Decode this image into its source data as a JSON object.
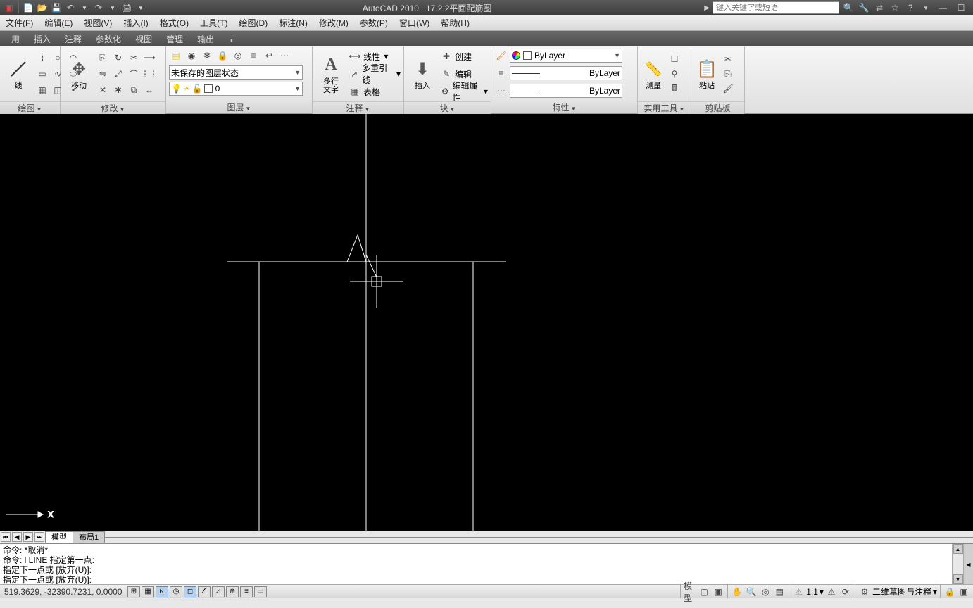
{
  "titlebar": {
    "app": "AutoCAD 2010",
    "doc": "17.2.2平面配筋图",
    "search_placeholder": "键入关键字或短语",
    "qat_icons": [
      "new",
      "open",
      "save",
      "undo",
      "redo",
      "print"
    ]
  },
  "menubar": [
    {
      "label": "文件",
      "key": "F"
    },
    {
      "label": "编辑",
      "key": "E"
    },
    {
      "label": "视图",
      "key": "V"
    },
    {
      "label": "插入",
      "key": "I"
    },
    {
      "label": "格式",
      "key": "O"
    },
    {
      "label": "工具",
      "key": "T"
    },
    {
      "label": "绘图",
      "key": "D"
    },
    {
      "label": "标注",
      "key": "N"
    },
    {
      "label": "修改",
      "key": "M"
    },
    {
      "label": "参数",
      "key": "P"
    },
    {
      "label": "窗口",
      "key": "W"
    },
    {
      "label": "帮助",
      "key": "H"
    }
  ],
  "tabs": [
    "用",
    "插入",
    "注释",
    "参数化",
    "视图",
    "管理",
    "输出"
  ],
  "ribbon": {
    "panels": {
      "draw": "绘图",
      "modify": "修改",
      "layer": "图层",
      "annot": "注释",
      "block": "块",
      "props": "特性",
      "util": "实用工具",
      "clip": "剪贴板"
    },
    "line_label": "线",
    "move_label": "移动",
    "text_label": "多行\n文字",
    "insert_label": "插入",
    "measure_label": "测量",
    "paste_label": "粘贴",
    "layer_state": "未保存的图层状态",
    "layer_current": "0",
    "annot_linear": "线性",
    "annot_mleader": "多重引线",
    "annot_table": "表格",
    "block_create": "创建",
    "block_edit": "编辑",
    "block_editattr": "编辑属性",
    "props_color": "ByLayer",
    "props_ltype": "ByLayer",
    "props_lweight": "ByLayer"
  },
  "model_tabs": {
    "model": "模型",
    "layout1": "布局1"
  },
  "command": {
    "line1": "命令: *取消*",
    "line2": "命令: l LINE 指定第一点:",
    "line3": "指定下一点或 [放弃(U)]:",
    "line4": "指定下一点或 [放弃(U)]:"
  },
  "statusbar": {
    "coords": "519.3629, -32390.7231, 0.0000",
    "model": "模型",
    "scale": "1:1",
    "workspace": "二维草图与注释"
  },
  "colors": {
    "accent": "#5a8ac0",
    "canvas_bg": "#000000",
    "draw_fg": "#ffffff"
  }
}
